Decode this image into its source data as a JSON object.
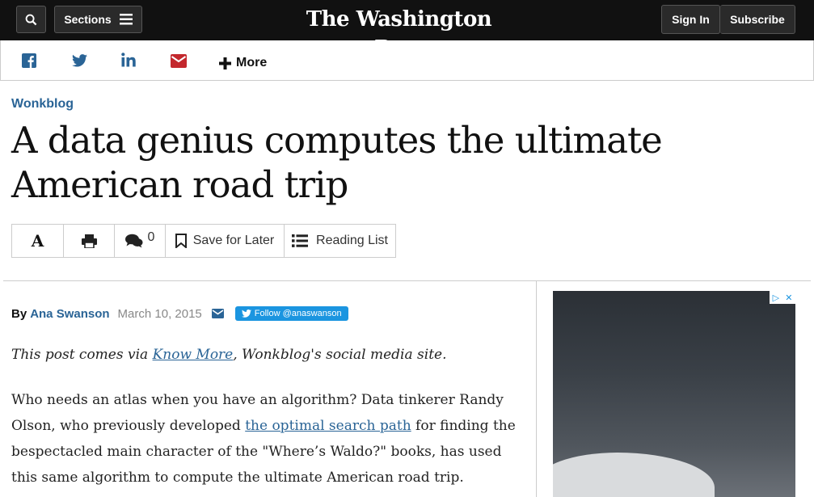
{
  "header": {
    "logo_text": "The Washington Post",
    "sections_label": "Sections",
    "signin_label": "Sign In",
    "subscribe_label": "Subscribe"
  },
  "share": {
    "more_label": "More",
    "icons": [
      "facebook-icon",
      "twitter-icon",
      "linkedin-icon",
      "email-icon"
    ]
  },
  "article": {
    "kicker": "Wonkblog",
    "headline": "A data genius computes the ultimate American road trip",
    "toolbar": {
      "comment_count": "0",
      "save_label": "Save for Later",
      "reading_list_label": "Reading List"
    },
    "byline": {
      "by": "By",
      "author": "Ana Swanson",
      "date": "March 10, 2015",
      "follow_label": "Follow @anaswanson"
    },
    "intro": {
      "before": "This post comes via ",
      "link": "Know More",
      "after": ", Wonkblog's social media site."
    },
    "para1": {
      "before": "Who needs an atlas when you have an algorithm? Data tinkerer Randy Olson, who previously developed ",
      "link": "the optimal search path",
      "after": " for finding the bespectacled main character of the \"Where’s Waldo?\" books, has used this same algorithm to compute the ultimate American road trip."
    }
  },
  "colors": {
    "topbar": "#111111",
    "accent_link": "#2a6496",
    "twitter_blue": "#1b95e0"
  }
}
